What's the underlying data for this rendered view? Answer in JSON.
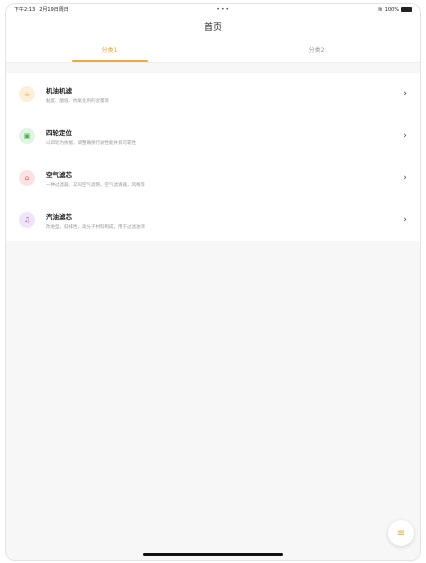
{
  "status_bar": {
    "time": "下午2:13",
    "date": "2月19日周日",
    "dots": "•••",
    "battery": "100%"
  },
  "nav": {
    "title": "首页"
  },
  "tabs": [
    {
      "label": "分类1",
      "active": true
    },
    {
      "label": "分类2",
      "active": false
    }
  ],
  "items": [
    {
      "title": "机油机滤",
      "subtitle": "黏度、酸值、抗氧化剂的含量等",
      "icon": "oil-icon",
      "icon_color": "#f0a93c",
      "icon_bg": "#fdf0d9",
      "glyph": "☕"
    },
    {
      "title": "四轮定位",
      "subtitle": "以四轮为依据，调整确保行驶性能并具可靠性",
      "icon": "wheel-alignment-icon",
      "icon_color": "#4caf50",
      "icon_bg": "#e2f4e2",
      "glyph": "▣"
    },
    {
      "title": "空气滤芯",
      "subtitle": "一种过滤器，又叫空气滤网，空气滤清器，风格等",
      "icon": "air-filter-icon",
      "icon_color": "#e05555",
      "icon_bg": "#fbe3e3",
      "glyph": "⌂"
    },
    {
      "title": "汽油滤芯",
      "subtitle": "改进型，低排性，高分子材料制成，用于过滤油滓",
      "icon": "fuel-filter-icon",
      "icon_color": "#9c6ad6",
      "icon_bg": "#efe4fa",
      "glyph": "♫"
    }
  ],
  "fab": {
    "icon": "menu-icon"
  }
}
